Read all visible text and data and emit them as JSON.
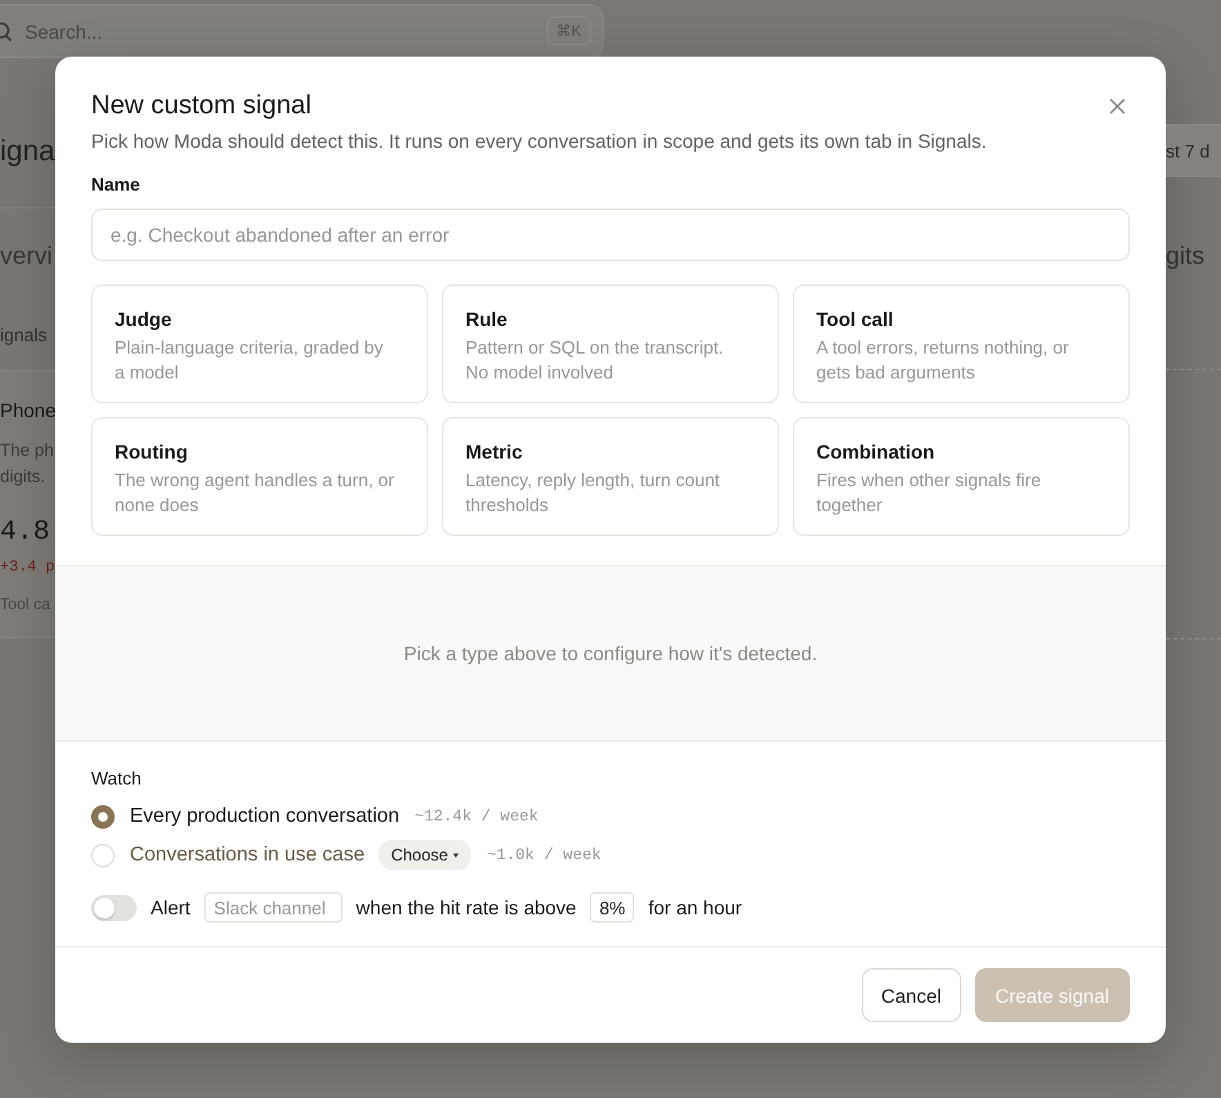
{
  "background": {
    "search": {
      "placeholder": "Search...",
      "shortcut": "⌘K"
    },
    "left": [
      {
        "kind": "heading",
        "text": "igna"
      },
      {
        "kind": "tab",
        "text": "vervi"
      },
      {
        "kind": "label",
        "text": "ignals"
      },
      {
        "kind": "title",
        "text": "Phone"
      },
      {
        "kind": "text",
        "text": "The ph"
      },
      {
        "kind": "text",
        "text": "digits."
      },
      {
        "kind": "number",
        "text": "4.8"
      },
      {
        "kind": "delta",
        "text": "+3.4 p"
      },
      {
        "kind": "caption",
        "text": "Tool ca"
      }
    ],
    "right": [
      {
        "kind": "range",
        "text": "st 7 d"
      },
      {
        "kind": "tab",
        "text": "gits"
      }
    ]
  },
  "modal": {
    "title": "New custom signal",
    "subtitle": "Pick how Moda should detect this. It runs on every conversation in scope and gets its own tab in Signals.",
    "name_field": {
      "label": "Name",
      "placeholder": "e.g. Checkout abandoned after an error"
    },
    "types": [
      {
        "title": "Judge",
        "description": "Plain-language criteria, graded by a model",
        "selected": false
      },
      {
        "title": "Rule",
        "description": "Pattern or SQL on the transcript. No model involved",
        "selected": false
      },
      {
        "title": "Tool call",
        "description": "A tool errors, returns nothing, or gets bad arguments",
        "selected": false
      },
      {
        "title": "Routing",
        "description": "The wrong agent handles a turn, or none does",
        "selected": false
      },
      {
        "title": "Metric",
        "description": "Latency, reply length, turn count thresholds",
        "selected": false
      },
      {
        "title": "Combination",
        "description": "Fires when other signals fire together",
        "selected": false
      }
    ],
    "config_hint": "Pick a type above to configure how it's detected.",
    "watch": {
      "label": "Watch",
      "options": [
        {
          "label": "Every production conversation",
          "count": "~12.4k / week",
          "selected": true
        },
        {
          "label": "Conversations in use case",
          "dropdown": "Choose",
          "count": "~1.0k / week",
          "selected": false
        }
      ]
    },
    "alert": {
      "on": false,
      "label": "Alert",
      "channel_placeholder": "Slack channel",
      "condition": "when the hit rate is above",
      "threshold": "8%",
      "duration": "for an hour"
    },
    "buttons": [
      {
        "label": "Cancel",
        "kind": "secondary",
        "disabled": false
      },
      {
        "label": "Create signal",
        "kind": "primary",
        "disabled": true
      }
    ]
  }
}
